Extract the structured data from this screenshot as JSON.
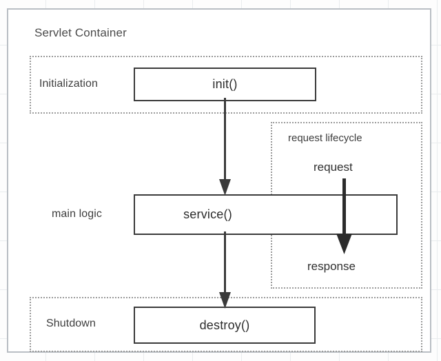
{
  "diagram": {
    "title": "Servlet Container",
    "background": {
      "grid_color": "#e9ecee",
      "page_color": "#fdfdfd"
    },
    "container": {
      "label": "Servlet Container",
      "border_color": "#b9bec4"
    },
    "regions": [
      {
        "id": "initialization",
        "label": "Initialization",
        "style": "dotted",
        "border_color": "#9a9a9a"
      },
      {
        "id": "request-lifecycle",
        "label": "request lifecycle",
        "style": "dotted",
        "border_color": "#9a9a9a"
      },
      {
        "id": "shutdown",
        "label": "Shutdown",
        "style": "dotted",
        "border_color": "#9a9a9a"
      }
    ],
    "phase_labels": {
      "initialization": "Initialization",
      "main_logic": "main logic",
      "shutdown": "Shutdown"
    },
    "lifecycle_labels": {
      "title": "request lifecycle",
      "request": "request",
      "response": "response"
    },
    "method_boxes": [
      {
        "id": "init",
        "label": "init()",
        "phase": "Initialization",
        "border_color": "#3a3a3a"
      },
      {
        "id": "service",
        "label": "service()",
        "phase": "main logic",
        "border_color": "#3a3a3a"
      },
      {
        "id": "destroy",
        "label": "destroy()",
        "phase": "Shutdown",
        "border_color": "#3a3a3a"
      }
    ],
    "arrows": [
      {
        "id": "init-to-service",
        "from": "init()",
        "to": "service()",
        "direction": "down",
        "color": "#3a3a3a"
      },
      {
        "id": "service-to-destroy",
        "from": "service()",
        "to": "destroy()",
        "direction": "down",
        "color": "#3a3a3a"
      },
      {
        "id": "request-to-response",
        "from": "request",
        "to": "response",
        "direction": "down",
        "color": "#2b2b2b"
      }
    ]
  }
}
